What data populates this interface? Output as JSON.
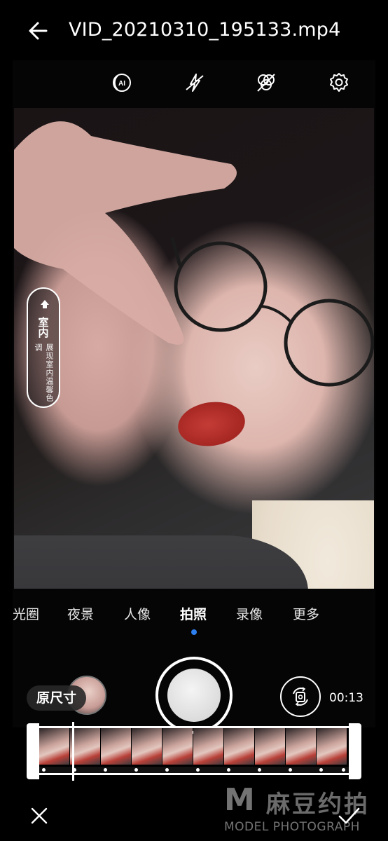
{
  "header": {
    "title": "VID_20210310_195133.mp4",
    "back_icon": "arrow-left-icon"
  },
  "toolbar": {
    "icons": [
      "ai-icon",
      "flash-off-icon",
      "filter-off-icon",
      "gear-icon"
    ]
  },
  "indoor_badge": {
    "title": "室内",
    "subtitle": "展现室内温馨色调",
    "icon": "home-icon"
  },
  "modes": {
    "items": [
      "光圈",
      "夜景",
      "人像",
      "拍照",
      "录像",
      "更多"
    ],
    "active": "拍照"
  },
  "controls": {
    "original_size_label": "原尺寸",
    "duration": "00:13"
  },
  "timeline": {
    "frame_count": 10,
    "playhead_fraction": 0.1
  },
  "bottom": {
    "cancel_icon": "close-icon",
    "confirm_icon": "check-icon"
  },
  "watermark": {
    "m": "M",
    "cn": "麻豆约拍",
    "en": "MODEL PHOTOGRAPH"
  },
  "colors": {
    "accent": "#2e7ff0",
    "background": "#000000"
  }
}
